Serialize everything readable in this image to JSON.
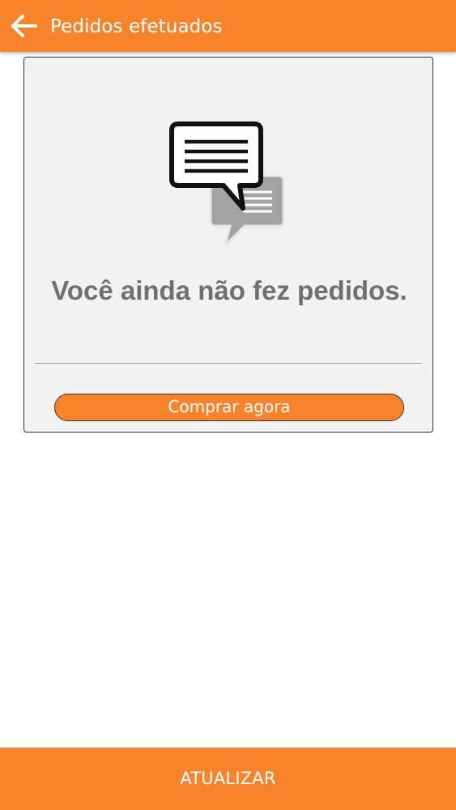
{
  "header": {
    "title": "Pedidos efetuados",
    "back_icon": "arrow-left-icon"
  },
  "empty_state": {
    "icon": "chat-bubbles-icon",
    "message": "Você ainda não fez pedidos.",
    "buy_button_label": "Comprar agora"
  },
  "footer": {
    "refresh_label": "ATUALIZAR"
  },
  "colors": {
    "accent": "#f7842d",
    "card_background": "#f2f2f2",
    "message_text": "#707070"
  }
}
